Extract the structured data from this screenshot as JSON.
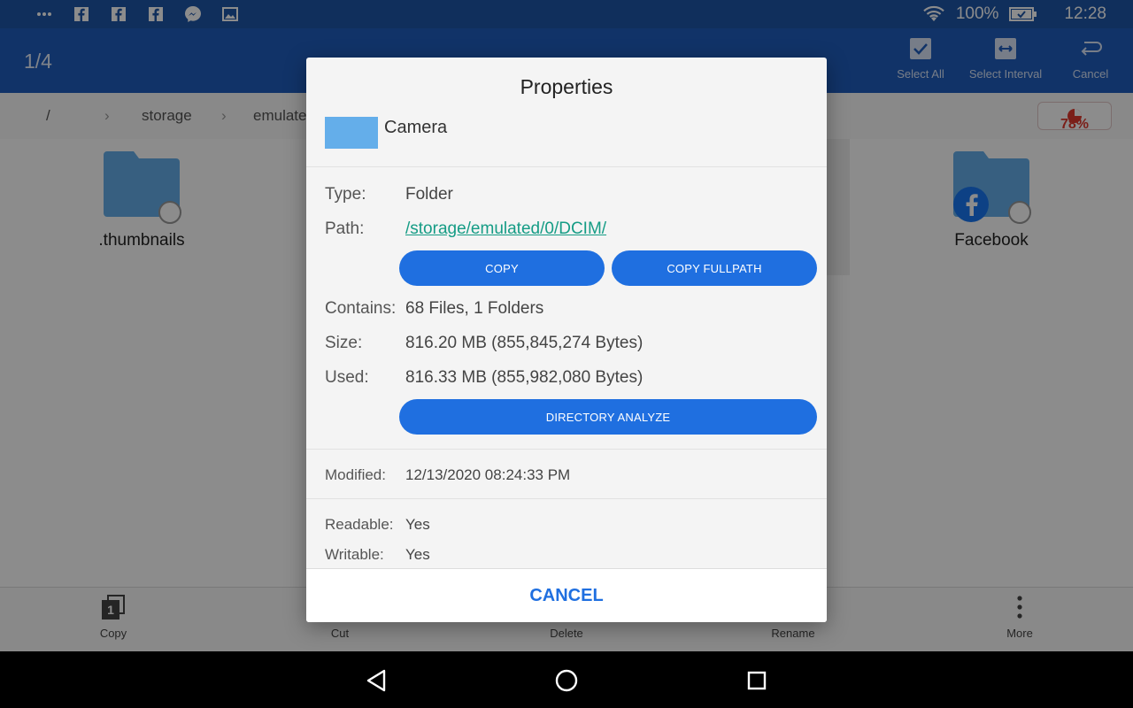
{
  "status_bar": {
    "battery": "100%",
    "time": "12:28",
    "notification_icons": [
      "more-icon",
      "facebook-icon",
      "facebook-icon",
      "facebook-icon",
      "messenger-icon",
      "image-icon"
    ]
  },
  "app_bar": {
    "selection_count": "1/4",
    "actions": {
      "select_all": "Select All",
      "select_interval": "Select Interval",
      "cancel": "Cancel"
    }
  },
  "path_bar": {
    "root": "/",
    "segments": [
      "storage",
      "emulate"
    ],
    "usage": "78%"
  },
  "files": [
    {
      "name": ".thumbnails"
    },
    {
      "name": "Facebook"
    }
  ],
  "toolbar": {
    "copy": "Copy",
    "copy_badge": "1",
    "cut": "Cut",
    "delete": "Delete",
    "rename": "Rename",
    "more": "More"
  },
  "dialog": {
    "title": "Properties",
    "folder_name": "Camera",
    "type_label": "Type:",
    "type_value": "Folder",
    "path_label": "Path:",
    "path_value": "/storage/emulated/0/DCIM/",
    "copy_button": "COPY",
    "copy_fullpath_button": "COPY FULLPATH",
    "contains_label": "Contains:",
    "contains_value": "68 Files, 1 Folders",
    "size_label": "Size:",
    "size_value": "816.20 MB (855,845,274 Bytes)",
    "used_label": "Used:",
    "used_value": "816.33 MB (855,982,080 Bytes)",
    "analyze_button": "DIRECTORY ANALYZE",
    "modified_label": "Modified:",
    "modified_value": "12/13/2020 08:24:33 PM",
    "readable_label": "Readable:",
    "readable_value": "Yes",
    "writable_label": "Writable:",
    "writable_value": "Yes",
    "cancel_button": "CANCEL"
  },
  "colors": {
    "app_bar": "#1f5dbd",
    "accent": "#1f6fe0",
    "link": "#159c85",
    "usage_red": "#e0392e"
  }
}
